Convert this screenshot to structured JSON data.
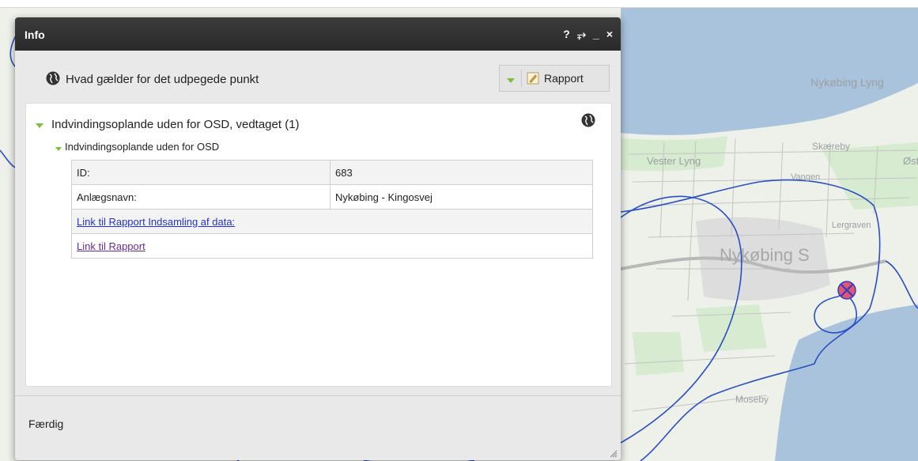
{
  "window": {
    "title": "Info",
    "controls": {
      "help": "?",
      "dock": "⥅",
      "minimize": "_",
      "close": "×"
    }
  },
  "header": {
    "icon": "globe-icon",
    "title": "Hvad gælder for det udpegede punkt",
    "report_button": {
      "label": "Rapport",
      "icons": [
        "expand-triangle-icon",
        "pencil-icon"
      ]
    }
  },
  "result": {
    "section_title": "Indvindingsoplande uden for OSD, vedtaget (1)",
    "section_icon": "globe-icon",
    "item_title": "Indvindingsoplande uden for OSD",
    "rows": [
      {
        "key": "ID:",
        "value": "683"
      },
      {
        "key": "Anlægsnavn:",
        "value": "Nykøbing - Kingosvej"
      }
    ],
    "links": [
      "Link til Rapport  Indsamling af data:",
      "Link til Rapport"
    ]
  },
  "footer": {
    "status": "Færdig"
  },
  "map": {
    "labels": [
      "Nykøbing Lyng",
      "Skæreby",
      "Vester Lyng",
      "Øst",
      "Vangen",
      "Lergraven",
      "Nykøbing S",
      "Moseby"
    ],
    "marker": "location-marker-icon",
    "colors": {
      "water": "#a9c3dc",
      "land": "#eef0ea",
      "green": "#d6ebcf",
      "boundary": "#2a4fc4",
      "marker": "#e2556a"
    }
  }
}
